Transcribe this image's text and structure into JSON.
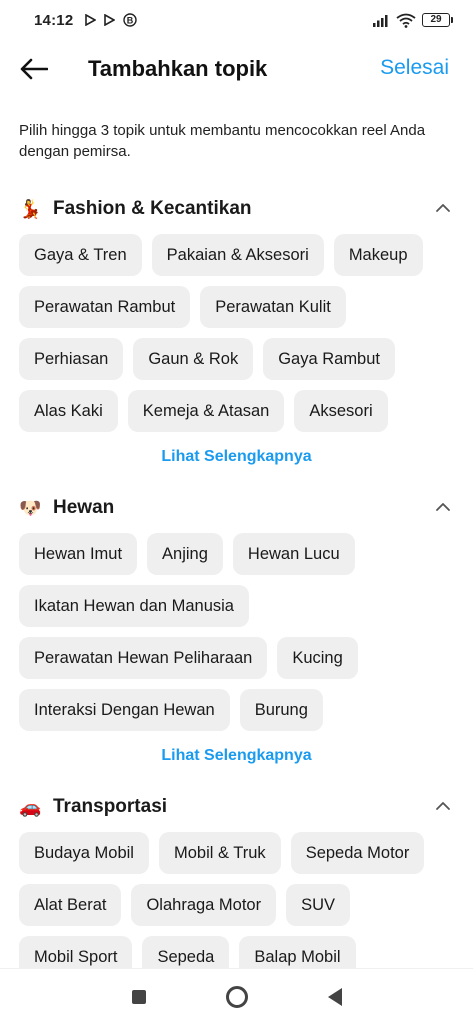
{
  "status_bar": {
    "time": "14:12",
    "battery": "29",
    "notification_icons": [
      "play-store-icon",
      "play-store-icon",
      "b-circle-icon"
    ]
  },
  "header": {
    "title": "Tambahkan topik",
    "done_label": "Selesai"
  },
  "intro_text": "Pilih hingga 3 topik untuk membantu mencocokkan reel Anda dengan pemirsa.",
  "sections": [
    {
      "emoji": "💃",
      "title": "Fashion & Kecantikan",
      "rows": [
        [
          "Gaya & Tren",
          "Pakaian & Aksesori",
          "Makeup"
        ],
        [
          "Perawatan Rambut",
          "Perawatan Kulit"
        ],
        [
          "Perhiasan",
          "Gaun & Rok",
          "Gaya Rambut"
        ],
        [
          "Alas Kaki",
          "Kemeja & Atasan",
          "Aksesori"
        ]
      ],
      "see_more": "Lihat Selengkapnya"
    },
    {
      "emoji": "🐶",
      "title": "Hewan",
      "rows": [
        [
          "Hewan Imut",
          "Anjing",
          "Hewan Lucu"
        ],
        [
          "Ikatan Hewan dan Manusia"
        ],
        [
          "Perawatan Hewan Peliharaan",
          "Kucing"
        ],
        [
          "Interaksi Dengan Hewan",
          "Burung"
        ]
      ],
      "see_more": "Lihat Selengkapnya"
    },
    {
      "emoji": "🚗",
      "title": "Transportasi",
      "rows": [
        [
          "Budaya Mobil",
          "Mobil & Truk",
          "Sepeda Motor"
        ],
        [
          "Alat Berat",
          "Olahraga Motor",
          "SUV"
        ],
        [
          "Mobil Sport",
          "Sepeda",
          "Balap Mobil"
        ]
      ]
    }
  ],
  "colors": {
    "accent": "#1a9bf0",
    "chip_bg": "#efefef",
    "text": "#1a1a1a"
  }
}
